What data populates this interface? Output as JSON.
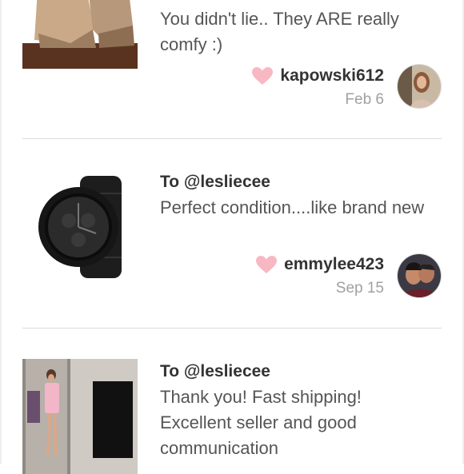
{
  "reviews": [
    {
      "to": "",
      "message": "You didn't lie.. They ARE really comfy :)",
      "username": "kapowski612",
      "date": "Feb 6",
      "thumbnail": "wedge-shoes-image",
      "avatar": "kapowski612-avatar"
    },
    {
      "to": "To @lesliecee",
      "message": "Perfect condition....like brand new",
      "username": "emmylee423",
      "date": "Sep 15",
      "thumbnail": "black-watch-image",
      "avatar": "emmylee423-avatar"
    },
    {
      "to": "To @lesliecee",
      "message": "Thank you! Fast shipping! Excellent seller and good communication",
      "username": "",
      "date": "",
      "thumbnail": "mirror-outfit-image",
      "avatar": ""
    }
  ],
  "colors": {
    "heart": "#f7b8c4",
    "text": "#333333",
    "muted": "#a0a0a0",
    "divider": "#dcdcdc"
  }
}
